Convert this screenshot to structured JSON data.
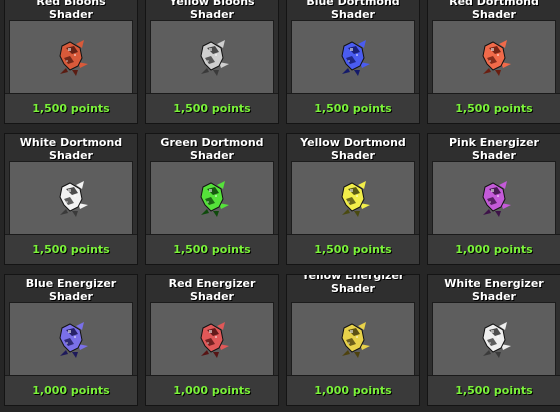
{
  "shop": {
    "items": [
      {
        "line1": "Red Bloons",
        "line2": "Shader",
        "price": "1,500 points",
        "color": "#d85a3a",
        "dark": "#5a1c12",
        "icon": "bloons-shader-sprite-icon"
      },
      {
        "line1": "Yellow Bloons",
        "line2": "Shader",
        "price": "1,500 points",
        "color": "#cfcfcf",
        "dark": "#3a3a3a",
        "icon": "bloons-shader-sprite-icon"
      },
      {
        "line1": "Blue Dortmond",
        "line2": "Shader",
        "price": "1,500 points",
        "color": "#4a5cf0",
        "dark": "#141a6a",
        "icon": "dortmond-shader-sprite-icon"
      },
      {
        "line1": "Red Dortmond",
        "line2": "Shader",
        "price": "1,500 points",
        "color": "#f06a4a",
        "dark": "#6a1e10",
        "icon": "dortmond-shader-sprite-icon"
      },
      {
        "line1": "White Dortmond",
        "line2": "Shader",
        "price": "1,500 points",
        "color": "#f2f2f2",
        "dark": "#3a3a3a",
        "icon": "dortmond-shader-sprite-icon"
      },
      {
        "line1": "Green Dortmond",
        "line2": "Shader",
        "price": "1,500 points",
        "color": "#55e23a",
        "dark": "#0f4a0c",
        "icon": "dortmond-shader-sprite-icon"
      },
      {
        "line1": "Yellow Dortmond",
        "line2": "Shader",
        "price": "1,500 points",
        "color": "#f2ee4a",
        "dark": "#4a4a10",
        "icon": "dortmond-shader-sprite-icon"
      },
      {
        "line1": "Pink Energizer",
        "line2": "Shader",
        "price": "1,000 points",
        "color": "#c35ad8",
        "dark": "#3d1248",
        "icon": "energizer-shader-sprite-icon"
      },
      {
        "line1": "Blue Energizer",
        "line2": "Shader",
        "price": "1,000 points",
        "color": "#7a70e8",
        "dark": "#1e1a5a",
        "icon": "energizer-shader-sprite-icon"
      },
      {
        "line1": "Red Energizer",
        "line2": "Shader",
        "price": "1,000 points",
        "color": "#e05858",
        "dark": "#561414",
        "icon": "energizer-shader-sprite-icon"
      },
      {
        "line1": "Yellow Energizer",
        "line2": "Shader",
        "price": "1,000 points",
        "color": "#e8d24a",
        "dark": "#4e420e",
        "icon": "energizer-shader-sprite-icon",
        "tall": true
      },
      {
        "line1": "White Energizer",
        "line2": "Shader",
        "price": "1,500 points",
        "color": "#eeeeee",
        "dark": "#3a3a3a",
        "icon": "energizer-shader-sprite-icon"
      }
    ]
  }
}
